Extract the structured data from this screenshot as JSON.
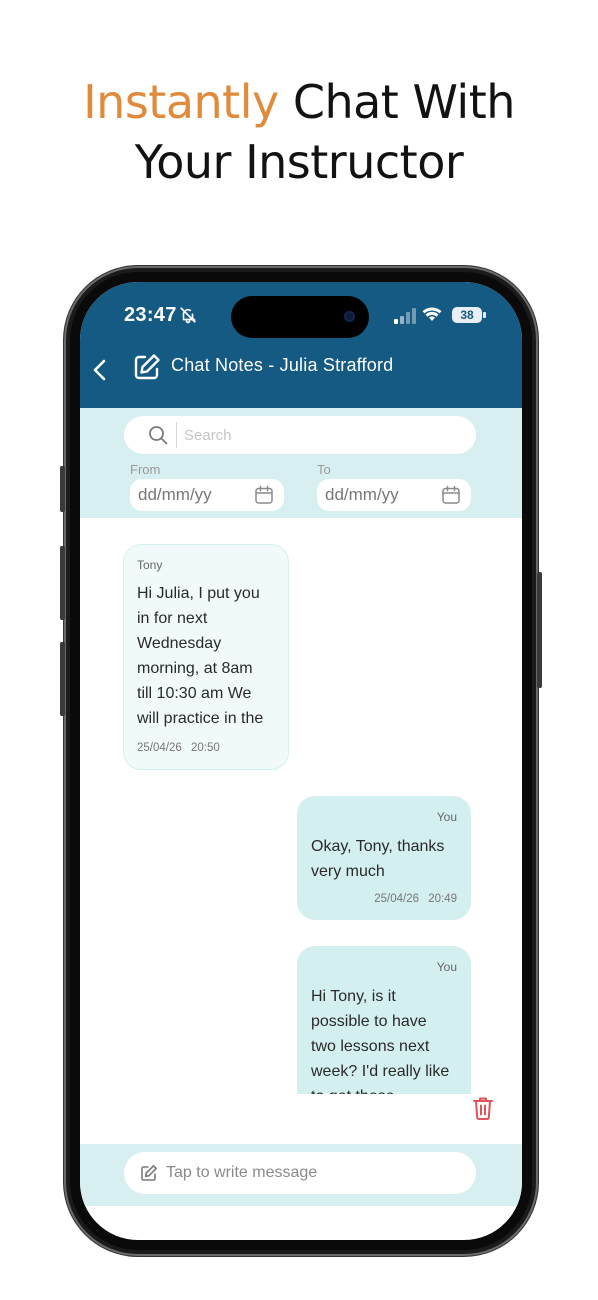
{
  "headline": {
    "accent": "Instantly",
    "rest": "Chat With",
    "line2": "Your Instructor"
  },
  "status_bar": {
    "time": "23:47",
    "battery": "38"
  },
  "header": {
    "title": "Chat Notes - Julia Strafford"
  },
  "filters": {
    "search_placeholder": "Search",
    "from_label": "From",
    "from_value": "dd/mm/yy",
    "to_label": "To",
    "to_value": "dd/mm/yy"
  },
  "messages": [
    {
      "sender": "Tony",
      "lines": [
        "Hi Julia, I put you",
        "in for next",
        "Wednesday",
        "morning, at 8am",
        "till 10:30 am We",
        "will practice in the"
      ],
      "date": "25/04/26",
      "time": "20:50"
    },
    {
      "sender": "You",
      "lines": [
        "Okay, Tony, thanks",
        "very much"
      ],
      "date": "25/04/26",
      "time": "20:49"
    },
    {
      "sender": "You",
      "lines": [
        "Hi Tony, is it",
        "possible to have",
        "two lessons next",
        "week? I'd really like",
        "to get these"
      ]
    }
  ],
  "composer": {
    "placeholder": "Tap to write message"
  },
  "colors": {
    "accent": "#e08a3c",
    "header": "#155a83",
    "panel": "#d8eff1",
    "bubble_mine": "#d4eff0",
    "trash": "#e0525e"
  },
  "icons": [
    "back-icon",
    "note-edit-icon",
    "search-icon",
    "calendar-icon",
    "trash-icon",
    "pencil-icon",
    "bell-slash-icon",
    "signal-icon",
    "wifi-icon",
    "battery-icon"
  ]
}
